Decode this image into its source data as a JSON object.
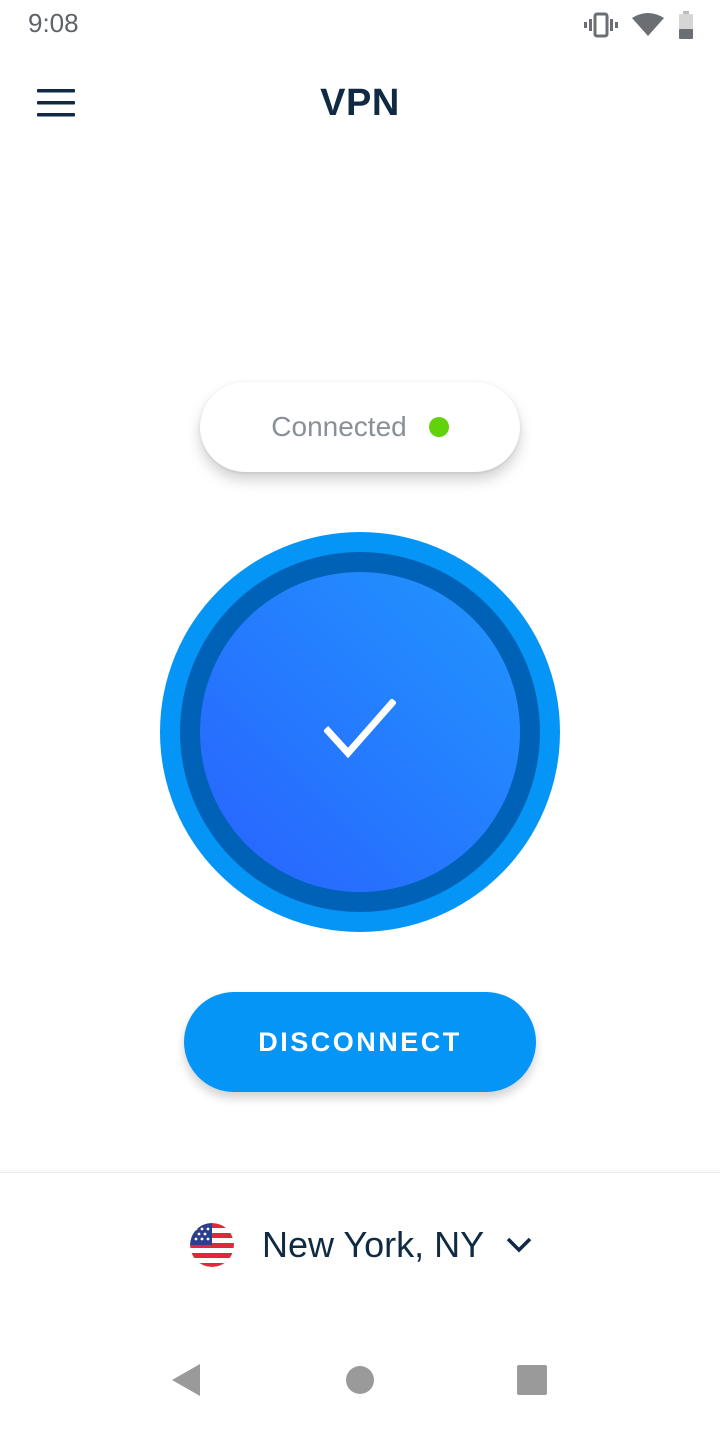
{
  "status_bar": {
    "time": "9:08",
    "icons": [
      "vibrate-icon",
      "wifi-icon",
      "battery-icon"
    ]
  },
  "app_bar": {
    "title": "VPN",
    "menu_icon": "hamburger-menu-icon"
  },
  "connection": {
    "status_text": "Connected",
    "status_color": "#62d20a",
    "state_icon": "checkmark-icon"
  },
  "actions": {
    "disconnect_label": "DISCONNECT"
  },
  "location": {
    "label": "New York, NY",
    "flag": "us-flag-icon",
    "chevron": "chevron-down-icon"
  },
  "nav_bar": {
    "items": [
      "back-icon",
      "home-icon",
      "recents-icon"
    ]
  },
  "colors": {
    "accent": "#0595f7",
    "ring_mid": "#0062b6",
    "core_gradient_start": "#2196fe",
    "core_gradient_end": "#2962ff",
    "title": "#102a43",
    "muted": "#8a8f98"
  }
}
